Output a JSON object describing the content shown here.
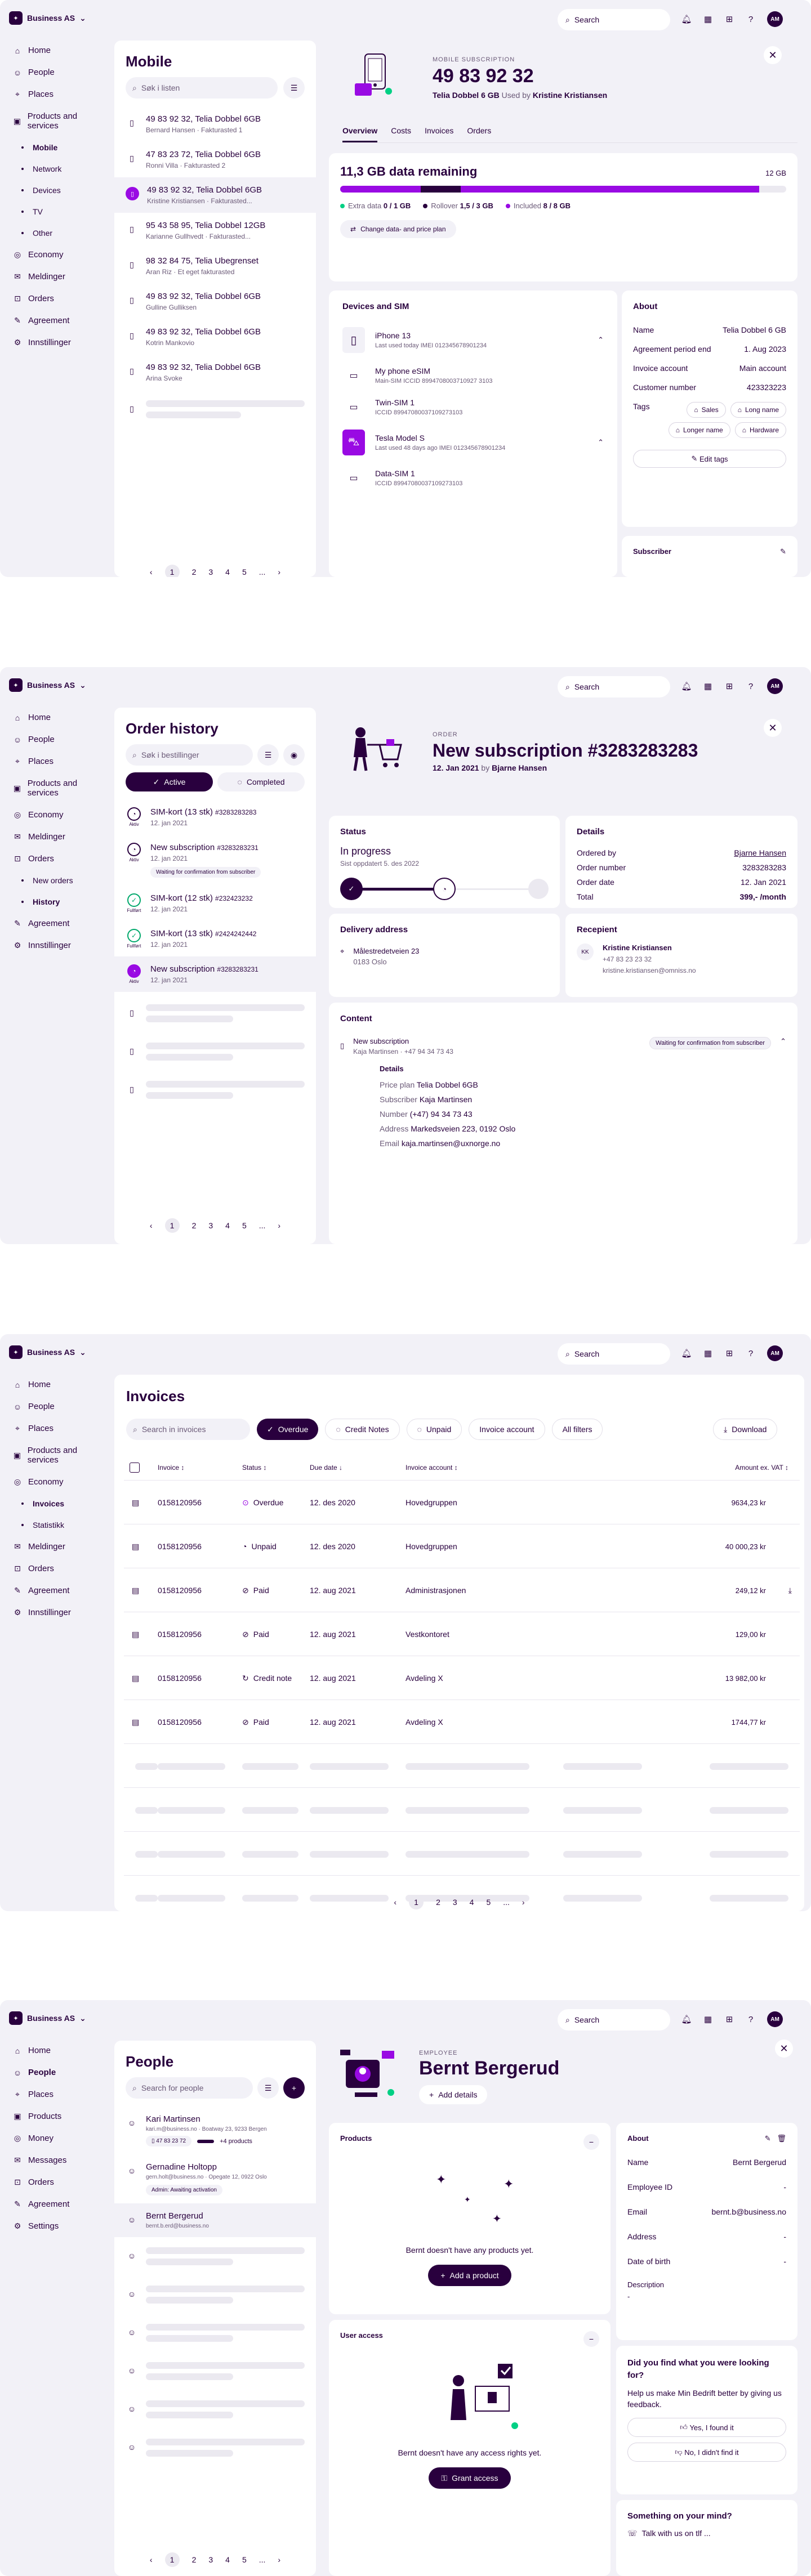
{
  "topbar": {
    "brand": "Business AS",
    "search_placeholder": "Search",
    "avatar_initials": "AM"
  },
  "screen1": {
    "nav": [
      {
        "label": "Home",
        "icon": "home-icon",
        "glyph": "⌂"
      },
      {
        "label": "People",
        "icon": "people-icon",
        "glyph": "☺"
      },
      {
        "label": "Places",
        "icon": "location-icon",
        "glyph": "⌖"
      },
      {
        "label": "Products and services",
        "icon": "box-icon",
        "glyph": "▣"
      },
      {
        "label": "Mobile",
        "sub": true,
        "active": true
      },
      {
        "label": "Network",
        "sub": true
      },
      {
        "label": "Devices",
        "sub": true
      },
      {
        "label": "TV",
        "sub": true
      },
      {
        "label": "Other",
        "sub": true
      },
      {
        "label": "Economy",
        "icon": "coins-icon",
        "glyph": "◎"
      },
      {
        "label": "Meldinger",
        "icon": "message-icon",
        "glyph": "✉"
      },
      {
        "label": "Orders",
        "icon": "cart-icon",
        "glyph": "⊡"
      },
      {
        "label": "Agreement",
        "icon": "handshake-icon",
        "glyph": "✎"
      },
      {
        "label": "Innstillinger",
        "icon": "settings-icon",
        "glyph": "⚙"
      }
    ],
    "list_title": "Mobile",
    "search_placeholder": "Søk i listen",
    "items": [
      {
        "title": "49 83 92 32, Telia Dobbel 6GB",
        "sub": "Bernard Hansen  ·  Fakturasted 1"
      },
      {
        "title": "47 83 23 72, Telia Dobbel 6GB",
        "sub": "Ronni Villa  ·  Fakturasted 2"
      },
      {
        "title": "49 83 92 32, Telia Dobbel 6GB",
        "sub": "Kristine Kristiansen  ·  Fakturasted...",
        "selected": true
      },
      {
        "title": "95 43 58 95, Telia Dobbel 12GB",
        "sub": "Karianne Gullhvedt  ·  Fakturasted..."
      },
      {
        "title": "98 32 84 75, Telia Ubegrenset",
        "sub": "Aran Riz  ·  Et eget fakturasted"
      },
      {
        "title": "49 83 92 32, Telia Dobbel 6GB",
        "sub": "Gulline Gulliksen"
      },
      {
        "title": "49 83 92 32, Telia Dobbel 6GB",
        "sub": "Kotrin Mankovio"
      },
      {
        "title": "49 83 92 32, Telia Dobbel 6GB",
        "sub": "Arina Svoke"
      }
    ],
    "pages": [
      "1",
      "2",
      "3",
      "4",
      "5",
      "..."
    ],
    "detail": {
      "eyebrow": "MOBILE SUBSCRIPTION",
      "number": "49 83 92 32",
      "plan": "Telia Dobbel 6 GB",
      "used_by_label": "Used by",
      "used_by": "Kristine Kristiansen",
      "tabs": [
        "Overview",
        "Costs",
        "Invoices",
        "Orders"
      ],
      "data_remaining": "11,3 GB data remaining",
      "data_total": "12 GB",
      "bar_fill_fraction": 0.94,
      "legend": [
        {
          "label": "Extra data",
          "value": "0 / 1 GB",
          "color": "#00d084"
        },
        {
          "label": "Rollover",
          "value": "1,5 / 3 GB",
          "color": "#29003e"
        },
        {
          "label": "Included",
          "value": "8 / 8 GB",
          "color": "#990ae3"
        }
      ],
      "change_plan": "Change data- and price plan",
      "devices_title": "Devices and SIM",
      "devices": [
        {
          "name": "iPhone 13",
          "sub": "Last used today  IMEI 012345678901234",
          "kind": "phone"
        },
        {
          "name": "My phone eSIM",
          "sub": "Main-SIM  ICCID 8994708003710927 3103",
          "kind": "sim"
        },
        {
          "name": "Twin-SIM 1",
          "sub": "ICCID 89947080037109273103",
          "kind": "sim"
        },
        {
          "name": "Tesla Model S",
          "sub": "Last used 48 days ago  IMEI 012345678901234",
          "kind": "car"
        },
        {
          "name": "Data-SIM 1",
          "sub": "ICCID 89947080037109273103",
          "kind": "sim"
        }
      ],
      "about_title": "About",
      "about": [
        {
          "label": "Name",
          "value": "Telia Dobbel 6 GB"
        },
        {
          "label": "Agreement period end",
          "value": "1. Aug 2023"
        },
        {
          "label": "Invoice account",
          "value": "Main account"
        },
        {
          "label": "Customer number",
          "value": "423323223"
        }
      ],
      "tags_label": "Tags",
      "tags": [
        "Sales",
        "Long name",
        "Longer name",
        "Hardware"
      ],
      "edit_tags": "Edit tags",
      "subscriber_title": "Subscriber"
    }
  },
  "screen2": {
    "nav": [
      {
        "label": "Home",
        "glyph": "⌂",
        "icon": "home-icon"
      },
      {
        "label": "People",
        "glyph": "☺",
        "icon": "people-icon"
      },
      {
        "label": "Places",
        "glyph": "⌖",
        "icon": "location-icon"
      },
      {
        "label": "Products and services",
        "glyph": "▣",
        "icon": "box-icon"
      },
      {
        "label": "Economy",
        "glyph": "◎",
        "icon": "coins-icon"
      },
      {
        "label": "Meldinger",
        "glyph": "✉",
        "icon": "message-icon"
      },
      {
        "label": "Orders",
        "glyph": "⊡",
        "icon": "cart-icon"
      },
      {
        "label": "New orders",
        "sub": true
      },
      {
        "label": "History",
        "sub": true,
        "active": true
      },
      {
        "label": "Agreement",
        "glyph": "✎",
        "icon": "handshake-icon"
      },
      {
        "label": "Innstillinger",
        "glyph": "⚙",
        "icon": "settings-icon"
      }
    ],
    "list_title": "Order history",
    "search_placeholder": "Søk i bestillinger",
    "toggle_active": "Active",
    "toggle_completed": "Completed",
    "items": [
      {
        "title": "SIM-kort (13 stk)",
        "id": "#3283283283",
        "date": "12. jan 2021",
        "state": "Aktiv"
      },
      {
        "title": "New subscription",
        "id": "#3283283231",
        "date": "12. jan 2021",
        "state": "Aktiv",
        "badge": "Waiting for confirmation from subscriber"
      },
      {
        "title": "SIM-kort (12 stk)",
        "id": "#232423232",
        "date": "12. jan 2021",
        "state": "Fullført"
      },
      {
        "title": "SIM-kort (13 stk)",
        "id": "#2424242442",
        "date": "12. jan 2021",
        "state": "Fullført"
      },
      {
        "title": "New subscription",
        "id": "#3283283231",
        "date": "12. jan 2021",
        "state": "Aktiv",
        "selected": true
      }
    ],
    "pages": [
      "1",
      "2",
      "3",
      "4",
      "5",
      "..."
    ],
    "detail": {
      "eyebrow": "ORDER",
      "title": "New subscription #3283283283",
      "date": "12. Jan 2021",
      "by_label": "by",
      "by": "Bjarne Hansen",
      "status_title": "Status",
      "status": "In progress",
      "status_sub": "Sist oppdatert 5. des 2022",
      "progress_fraction": 0.5,
      "details_title": "Details",
      "details": [
        {
          "label": "Ordered by",
          "value": "Bjarne Hansen"
        },
        {
          "label": "Order number",
          "value": "3283283283"
        },
        {
          "label": "Order date",
          "value": "12. Jan 2021"
        },
        {
          "label": "Total",
          "value": "399,- /month"
        }
      ],
      "delivery_title": "Delivery address",
      "address1": "Målestredetveien 23",
      "address2": "0183 Oslo",
      "recipient_title": "Recepient",
      "recipient_initials": "KK",
      "recipient_name": "Kristine Kristiansen",
      "recipient_phone": "+47 83 23 23 32",
      "recipient_email": "kristine.kristiansen@omniss.no",
      "content_title": "Content",
      "content_name": "New subscription",
      "content_sub": "Kaja Martinsen  ·  +47 94 34 73 43",
      "content_badge": "Waiting for confirmation from subscriber",
      "content_details_title": "Details",
      "content_details": [
        {
          "label": "Price plan",
          "value": "Telia Dobbel 6GB"
        },
        {
          "label": "Subscriber",
          "value": "Kaja Martinsen"
        },
        {
          "label": "Number",
          "value": "(+47) 94 34 73 43"
        },
        {
          "label": "Address",
          "value": "Markedsveien 223, 0192 Oslo"
        },
        {
          "label": "Email",
          "value": "kaja.martinsen@uxnorge.no"
        }
      ]
    }
  },
  "screen3": {
    "nav": [
      {
        "label": "Home",
        "glyph": "⌂",
        "icon": "home-icon"
      },
      {
        "label": "People",
        "glyph": "☺",
        "icon": "people-icon"
      },
      {
        "label": "Places",
        "glyph": "⌖",
        "icon": "location-icon"
      },
      {
        "label": "Products and services",
        "glyph": "▣",
        "icon": "box-icon"
      },
      {
        "label": "Economy",
        "glyph": "◎",
        "icon": "coins-icon"
      },
      {
        "label": "Invoices",
        "sub": true,
        "active": true
      },
      {
        "label": "Statistikk",
        "sub": true
      },
      {
        "label": "Meldinger",
        "glyph": "✉",
        "icon": "message-icon"
      },
      {
        "label": "Orders",
        "glyph": "⊡",
        "icon": "cart-icon"
      },
      {
        "label": "Agreement",
        "glyph": "✎",
        "icon": "handshake-icon"
      },
      {
        "label": "Innstillinger",
        "glyph": "⚙",
        "icon": "settings-icon"
      }
    ],
    "title": "Invoices",
    "search_placeholder": "Search in invoices",
    "filters": [
      {
        "label": "Overdue",
        "active": true
      },
      {
        "label": "Credit Notes"
      },
      {
        "label": "Unpaid"
      },
      {
        "label": "Invoice account"
      },
      {
        "label": "All filters"
      }
    ],
    "download": "Download",
    "columns": [
      "Invoice",
      "Status",
      "Due date",
      "Invoice account",
      "Amount ex. VAT"
    ],
    "rows": [
      {
        "invoice": "0158120956",
        "status": "Overdue",
        "due": "12. des 2020",
        "account": "Hovedgruppen",
        "amount": "9634,23 kr",
        "status_color": "#990ae3"
      },
      {
        "invoice": "0158120956",
        "status": "Unpaid",
        "due": "12. des 2020",
        "account": "Hovedgruppen",
        "amount": "40 000,23 kr",
        "status_color": "#29003e"
      },
      {
        "invoice": "0158120956",
        "status": "Paid",
        "due": "12. aug 2021",
        "account": "Administrasjonen",
        "amount": "249,12 kr",
        "status_color": "#29003e",
        "download": true
      },
      {
        "invoice": "0158120956",
        "status": "Paid",
        "due": "12. aug 2021",
        "account": "Vestkontoret",
        "amount": "129,00 kr",
        "status_color": "#29003e"
      },
      {
        "invoice": "0158120956",
        "status": "Credit note",
        "due": "12. aug 2021",
        "account": "Avdeling X",
        "amount": "13 982,00 kr",
        "status_color": "#29003e"
      },
      {
        "invoice": "0158120956",
        "status": "Paid",
        "due": "12. aug 2021",
        "account": "Avdeling X",
        "amount": "1744,77 kr",
        "status_color": "#29003e"
      }
    ],
    "pages": [
      "1",
      "2",
      "3",
      "4",
      "5",
      "..."
    ]
  },
  "screen4": {
    "nav": [
      {
        "label": "Home",
        "glyph": "⌂",
        "icon": "home-icon"
      },
      {
        "label": "People",
        "glyph": "☺",
        "icon": "people-icon",
        "active": true
      },
      {
        "label": "Places",
        "glyph": "⌖",
        "icon": "location-icon"
      },
      {
        "label": "Products",
        "glyph": "▣",
        "icon": "box-icon"
      },
      {
        "label": "Money",
        "glyph": "◎",
        "icon": "coins-icon"
      },
      {
        "label": "Messages",
        "glyph": "✉",
        "icon": "message-icon"
      },
      {
        "label": "Orders",
        "glyph": "⊡",
        "icon": "cart-icon"
      },
      {
        "label": "Agreement",
        "glyph": "✎",
        "icon": "handshake-icon"
      },
      {
        "label": "Settings",
        "glyph": "⚙",
        "icon": "settings-icon"
      }
    ],
    "list_title": "People",
    "search_placeholder": "Search for people",
    "people": [
      {
        "name": "Kari Martinsen",
        "sub": "kari.m@business.no  ·  Boatway 23, 9233 Bergen",
        "phone": "47 83 23 72",
        "products": "+4 products"
      },
      {
        "name": "Gernadine Holtopp",
        "sub": "gern.holt@business.no  ·  Opegate 12, 0922 Oslo",
        "badge": "Admin: Awaiting activation"
      },
      {
        "name": "Bernt Bergerud",
        "sub": "bernt.b.erd@business.no",
        "selected": true
      }
    ],
    "pages": [
      "1",
      "2",
      "3",
      "4",
      "5",
      "..."
    ],
    "detail": {
      "eyebrow": "EMPLOYEE",
      "name": "Bernt Bergerud",
      "add_details": "Add details",
      "products_title": "Products",
      "products_empty": "Bernt doesn't have any products yet.",
      "add_product": "Add a product",
      "access_title": "User access",
      "access_empty": "Bernt doesn't have any access rights yet.",
      "grant_access": "Grant access",
      "about_title": "About",
      "about": [
        {
          "label": "Name",
          "value": "Bernt Bergerud"
        },
        {
          "label": "Employee ID",
          "value": "-"
        },
        {
          "label": "Email",
          "value": "bernt.b@business.no"
        },
        {
          "label": "Address",
          "value": "-"
        },
        {
          "label": "Date of birth",
          "value": "-"
        }
      ],
      "description_label": "Description",
      "description_value": "-",
      "feedback_title": "Did you find what you were looking for?",
      "feedback_text": "Help us make Min Bedrift better by giving us feedback.",
      "feedback_yes": "Yes, I found it",
      "feedback_no": "No, I didn't find it",
      "mind_title": "Something on your mind?",
      "talk": "Talk with us on tlf ..."
    }
  }
}
